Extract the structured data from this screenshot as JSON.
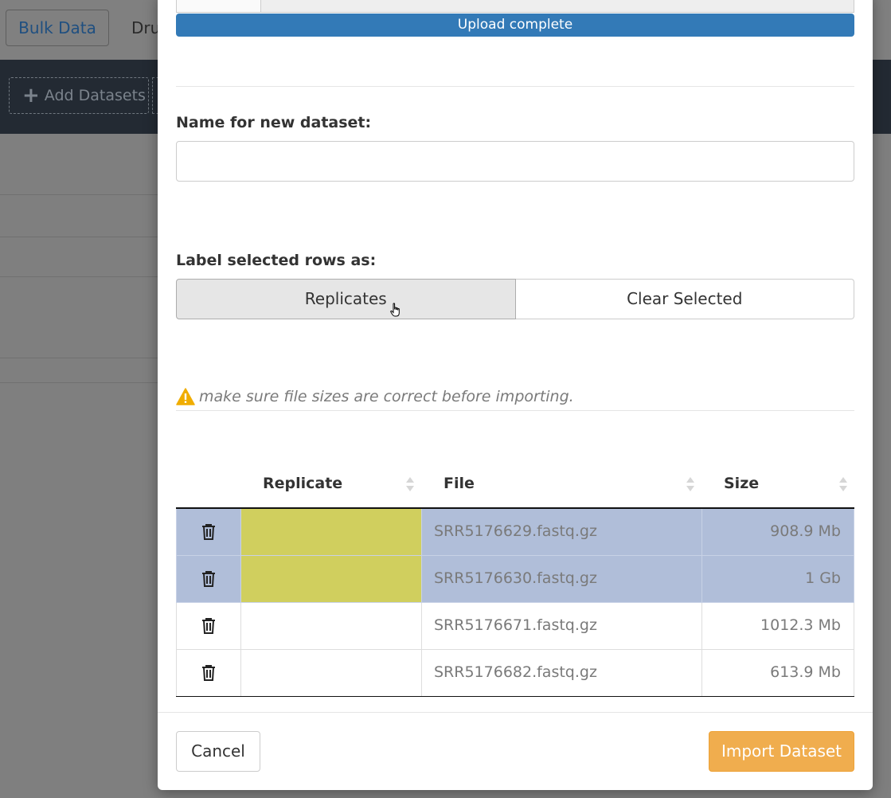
{
  "background": {
    "tabs": [
      {
        "label": "Bulk Data"
      },
      {
        "label": "Dru"
      }
    ],
    "add_datasets_label": "Add Datasets"
  },
  "modal": {
    "upload_status": "Upload complete",
    "upload_progress_percent": 100,
    "name_label": "Name for new dataset:",
    "name_value": "",
    "label_rows_label": "Label selected rows as:",
    "label_buttons": {
      "replicates": "Replicates",
      "clear_selected": "Clear Selected"
    },
    "warning_text": "make sure file sizes are correct before importing.",
    "table": {
      "columns": {
        "replicate": "Replicate",
        "file": "File",
        "size": "Size"
      },
      "rows": [
        {
          "replicate": "",
          "file": "SRR5176629.fastq.gz",
          "size": "908.9 Mb",
          "selected": true
        },
        {
          "replicate": "",
          "file": "SRR5176630.fastq.gz",
          "size": "1 Gb",
          "selected": true
        },
        {
          "replicate": "",
          "file": "SRR5176671.fastq.gz",
          "size": "1012.3 Mb",
          "selected": false
        },
        {
          "replicate": "",
          "file": "SRR5176682.fastq.gz",
          "size": "613.9 Mb",
          "selected": false
        }
      ]
    },
    "footer": {
      "cancel_label": "Cancel",
      "import_label": "Import Dataset"
    }
  },
  "colors": {
    "progress": "#337ab7",
    "selected_row": "#b0bed9",
    "replicate_highlight": "#d0cf5e",
    "import_button": "#f0ad4e"
  }
}
